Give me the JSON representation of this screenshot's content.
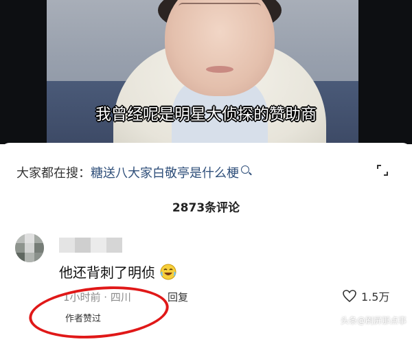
{
  "video": {
    "caption": "我曾经呢是明星大侦探的赞助商"
  },
  "search": {
    "prefix": "大家都在搜：",
    "term": "糖送八大家白敬亭是什么梗"
  },
  "comments": {
    "count_label": "2873条评论",
    "items": [
      {
        "text": "他还背刺了明侦",
        "time_location": "1小时前 · 四川",
        "reply_label": "回复",
        "like_count": "1.5万",
        "author_liked_label": "作者赞过"
      }
    ]
  },
  "watermark": "头条@刷屏那点事"
}
